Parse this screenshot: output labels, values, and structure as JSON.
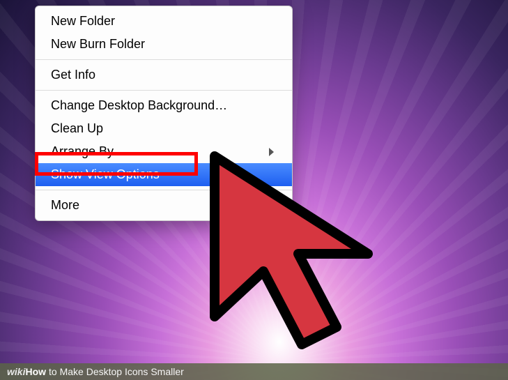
{
  "menu": {
    "items": [
      {
        "label": "New Folder"
      },
      {
        "label": "New Burn Folder"
      }
    ],
    "items2": [
      {
        "label": "Get Info"
      }
    ],
    "items3": [
      {
        "label": "Change Desktop Background…"
      },
      {
        "label": "Clean Up"
      },
      {
        "label": "Arrange By",
        "hasSubmenu": true
      },
      {
        "label": "Show View Options",
        "highlighted": true
      }
    ],
    "items4": [
      {
        "label": "More"
      }
    ]
  },
  "footer": {
    "wiki": "wiki",
    "how": "How",
    "title": "to Make Desktop Icons Smaller"
  }
}
